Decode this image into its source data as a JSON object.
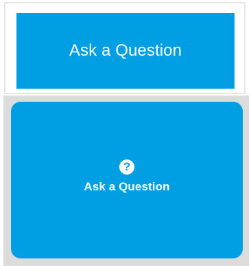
{
  "top_card": {
    "button_label": "Ask a Question"
  },
  "bottom_card": {
    "icon": "question-circle-icon",
    "icon_glyph": "?",
    "button_label": "Ask a Question"
  },
  "colors": {
    "accent": "#009fe3",
    "panel_bg": "#dcdcdc",
    "card_border": "#e6e6e6"
  }
}
